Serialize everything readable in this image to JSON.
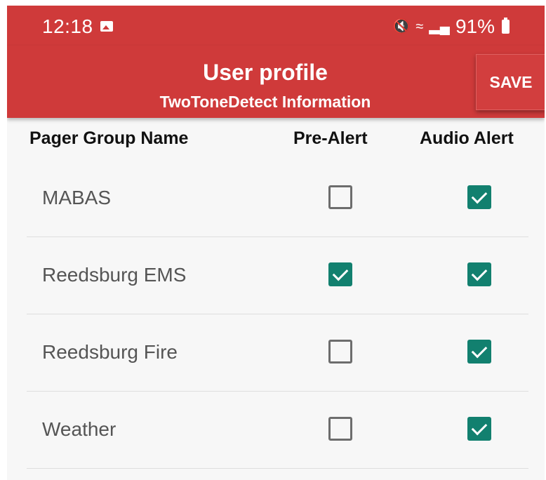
{
  "status_bar": {
    "time": "12:18",
    "battery": "91%",
    "icons": [
      "gallery-icon",
      "mute-icon",
      "wifi-icon",
      "signal-icon",
      "battery-icon"
    ]
  },
  "app_bar": {
    "title": "User profile",
    "subtitle": "TwoToneDetect Information",
    "save_label": "SAVE",
    "color": "#cf3a3a"
  },
  "table": {
    "headers": [
      "Pager Group Name",
      "Pre-Alert",
      "Audio Alert"
    ],
    "rows": [
      {
        "name": "MABAS",
        "pre_alert": false,
        "audio_alert": true
      },
      {
        "name": "Reedsburg EMS",
        "pre_alert": true,
        "audio_alert": true
      },
      {
        "name": "Reedsburg Fire",
        "pre_alert": false,
        "audio_alert": true
      },
      {
        "name": "Weather",
        "pre_alert": false,
        "audio_alert": true
      }
    ],
    "checked_color": "#12806f"
  }
}
